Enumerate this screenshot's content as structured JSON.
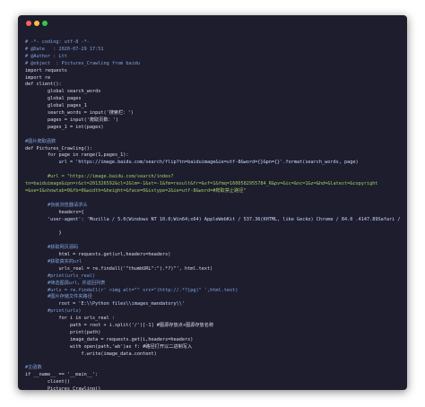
{
  "lines": [
    {
      "text": "# -*- coding: utf-8 -*-",
      "color": "comment"
    },
    {
      "text": "# @Date   : 2020-07-29 17:51",
      "color": "comment"
    },
    {
      "text": "# @Author : Ltt",
      "color": "comment"
    },
    {
      "text": "# @object  : Pictures_Crawling from baidu",
      "color": "comment"
    },
    {
      "text": "import requests",
      "color": "plain"
    },
    {
      "text": "import re",
      "color": "plain"
    },
    {
      "text": "def client():",
      "color": "plain"
    },
    {
      "text": "        global search_words",
      "color": "plain"
    },
    {
      "text": "        global pages",
      "color": "plain"
    },
    {
      "text": "        global pages_1",
      "color": "plain"
    },
    {
      "text": "        search_words = input('搜索栏：')",
      "color": "plain"
    },
    {
      "text": "        pages = input('爬取页数：')",
      "color": "plain"
    },
    {
      "text": "        pages_1 = int(pages)",
      "color": "plain"
    },
    {
      "text": "",
      "color": "plain"
    },
    {
      "text": "#图片爬取函数",
      "color": "comment"
    },
    {
      "text": "def Pictures_Crawling():",
      "color": "plain"
    },
    {
      "text": "        for page in range(1,pages_1):",
      "color": "plain"
    },
    {
      "text": "            url = 'https://image.baidu.com/search/flip?tn=baiduimage&ie=utf-8&word={}&pn={}'.format(search_words, page)",
      "color": "string"
    },
    {
      "text": "",
      "color": "plain"
    },
    {
      "text": "        #url = \"https://image.baidu.com/search/index?",
      "color": "green"
    },
    {
      "text": "tn=baiduimage&ipn=r&ct=201326592&cl=2&lm=-1&st=-1&fm=result&fr=&sf=1&fmq=1600582955784_R&pv=&ic=&nc=1&z=&hd=&latest=&copyright",
      "color": "green"
    },
    {
      "text": "=&se=1&showtab=0&fb=0&width=&height=&face=0&istype=2&ie=utf-8&word=#爬取禁止路径\"",
      "color": "green"
    },
    {
      "text": "",
      "color": "plain"
    },
    {
      "text": "        #伪装浏览器请求头",
      "color": "comment"
    },
    {
      "text": "            headers={",
      "color": "plain"
    },
    {
      "text": "        'user-agent': 'Mozilla / 5.0(Windows NT 10.0;Win64;x64) AppleWebKit / 537.36(KHTML, like Gecko) Chrome / 84.0 .4147.89Safari / 537.36'",
      "color": "string"
    },
    {
      "text": "",
      "color": "plain"
    },
    {
      "text": "            }",
      "color": "plain"
    },
    {
      "text": "",
      "color": "plain"
    },
    {
      "text": "        #获取网页源码",
      "color": "comment"
    },
    {
      "text": "            html = requests.get(url,headers=headers)",
      "color": "plain"
    },
    {
      "text": "        #获取真实的url",
      "color": "comment"
    },
    {
      "text": "            urls_real = re.findall('\"thumbURL\":\"(.*?)\"', html.text)",
      "color": "plain"
    },
    {
      "text": "        #print(urls_real)",
      "color": "comment"
    },
    {
      "text": "        #筛选图源url，并返回列表",
      "color": "comment"
    },
    {
      "text": "        #urls = re.findall(r' <img alt=\"\" src=\"(http://.*?jpg)\" ',html.text)",
      "color": "comment"
    },
    {
      "text": "        #图片存储文件夹路径",
      "color": "comment"
    },
    {
      "text": "            root = 'E:\\\\Python files\\\\images_mandatory\\\\'",
      "color": "string"
    },
    {
      "text": "        #print(urls)",
      "color": "comment"
    },
    {
      "text": "            for i in urls_real :",
      "color": "plain"
    },
    {
      "text": "                path = root + i.split('/')[-1] #图源存放点+图源存放名称",
      "color": "plain"
    },
    {
      "text": "                print(path)",
      "color": "plain"
    },
    {
      "text": "                image_data = requests.get(i,headers=headers)",
      "color": "plain"
    },
    {
      "text": "                with open(path,'wb')as f: #路径打开以二进制写入",
      "color": "plain"
    },
    {
      "text": "                    f.write(image_data.content)",
      "color": "plain"
    },
    {
      "text": "",
      "color": "plain"
    },
    {
      "text": "#主函数",
      "color": "comment"
    },
    {
      "text": "if __name__ == '__main__':",
      "color": "plain"
    },
    {
      "text": "        client()",
      "color": "plain"
    },
    {
      "text": "        Pictures_Crawling()",
      "color": "plain"
    }
  ]
}
